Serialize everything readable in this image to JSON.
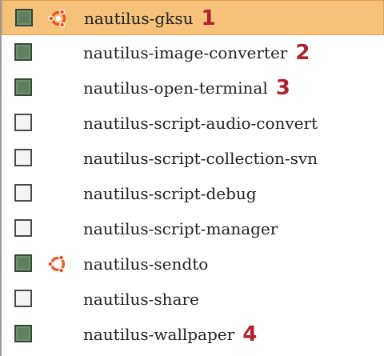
{
  "packages": [
    {
      "name": "nautilus-gksu",
      "checked": true,
      "ubuntu_icon": true,
      "selected": true,
      "marker": "1"
    },
    {
      "name": "nautilus-image-converter",
      "checked": true,
      "ubuntu_icon": false,
      "selected": false,
      "marker": "2"
    },
    {
      "name": "nautilus-open-terminal",
      "checked": true,
      "ubuntu_icon": false,
      "selected": false,
      "marker": "3"
    },
    {
      "name": "nautilus-script-audio-convert",
      "checked": false,
      "ubuntu_icon": false,
      "selected": false,
      "marker": ""
    },
    {
      "name": "nautilus-script-collection-svn",
      "checked": false,
      "ubuntu_icon": false,
      "selected": false,
      "marker": ""
    },
    {
      "name": "nautilus-script-debug",
      "checked": false,
      "ubuntu_icon": false,
      "selected": false,
      "marker": ""
    },
    {
      "name": "nautilus-script-manager",
      "checked": false,
      "ubuntu_icon": false,
      "selected": false,
      "marker": ""
    },
    {
      "name": "nautilus-sendto",
      "checked": true,
      "ubuntu_icon": true,
      "selected": false,
      "marker": ""
    },
    {
      "name": "nautilus-share",
      "checked": false,
      "ubuntu_icon": false,
      "selected": false,
      "marker": ""
    },
    {
      "name": "nautilus-wallpaper",
      "checked": true,
      "ubuntu_icon": false,
      "selected": false,
      "marker": "4"
    }
  ],
  "icons": {
    "ubuntu": "ubuntu-logo-icon"
  },
  "colors": {
    "selected_row": "#f6c17b",
    "checkbox_checked": "#5f7f5f",
    "marker": "#b02030",
    "ubuntu_logo": "#e95420"
  }
}
